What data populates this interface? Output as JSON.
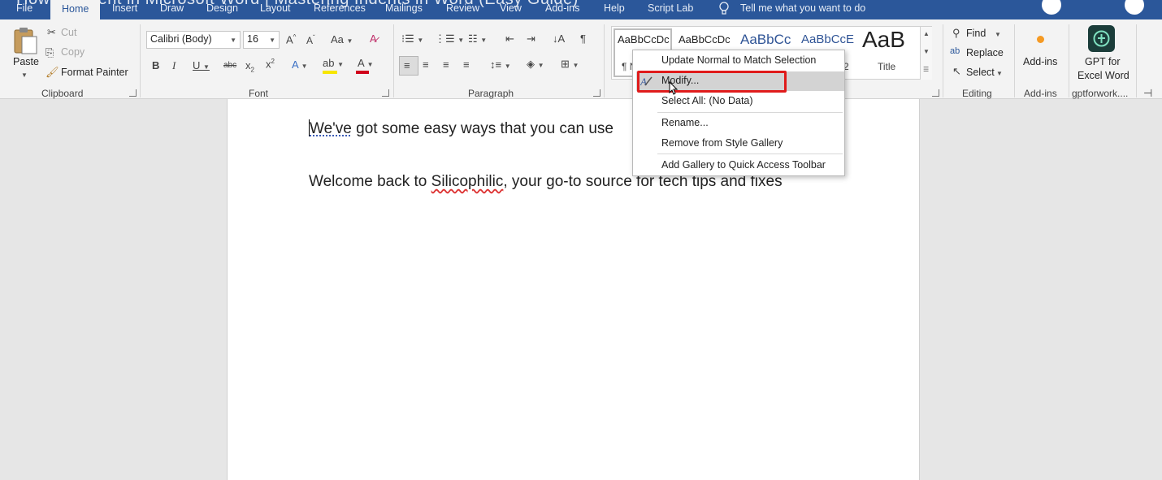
{
  "window": {
    "title_fragment": "How to Indent in Microsoft Word | Mastering Indents in Word (Easy Guide)"
  },
  "tabs": [
    "File",
    "Home",
    "Insert",
    "Draw",
    "Design",
    "Layout",
    "References",
    "Mailings",
    "Review",
    "View",
    "Add-ins",
    "Help",
    "Script Lab"
  ],
  "active_tab": "Home",
  "tell_me": "Tell me what you want to do",
  "clipboard": {
    "paste": "Paste",
    "cut": "Cut",
    "copy": "Copy",
    "format_painter": "Format Painter",
    "label": "Clipboard"
  },
  "font": {
    "name": "Calibri (Body)",
    "size": "16",
    "label": "Font"
  },
  "paragraph": {
    "label": "Paragraph"
  },
  "styles": {
    "items": [
      {
        "preview": "AaBbCcDc",
        "name": "¶ N"
      },
      {
        "preview": "AaBbCcDc",
        "name": ""
      },
      {
        "preview": "AaBbCc",
        "name": ""
      },
      {
        "preview": "AaBbCcE",
        "name": "2"
      },
      {
        "preview": "AaB",
        "name": "Title"
      }
    ]
  },
  "editing": {
    "find": "Find",
    "replace": "Replace",
    "select": "Select",
    "label": "Editing"
  },
  "addins": {
    "button": "Add-ins",
    "label": "Add-ins"
  },
  "gpt": {
    "line1": "GPT for",
    "line2": "Excel Word",
    "label": "gptforwork...."
  },
  "context_menu": {
    "items": [
      "Update Normal to Match Selection",
      "Modify...",
      "Select All: (No Data)",
      "Rename...",
      "Remove from Style Gallery",
      "Add Gallery to Quick Access Toolbar"
    ],
    "highlighted": "Modify..."
  },
  "document": {
    "line1_part1": "We've",
    "line1_part2": " got some easy ways that you can use",
    "line2_part1": "Welcome back to ",
    "line2_brand": "Silicophilic",
    "line2_part2": ", your go-to source for tech tips and fixes"
  },
  "colors": {
    "title_bar": "#2b579a",
    "ribbon": "#f3f3f3",
    "highlight_box": "#e01b1b",
    "font_color_bar": "#d0021b",
    "highlight_bar": "#f7e600"
  }
}
